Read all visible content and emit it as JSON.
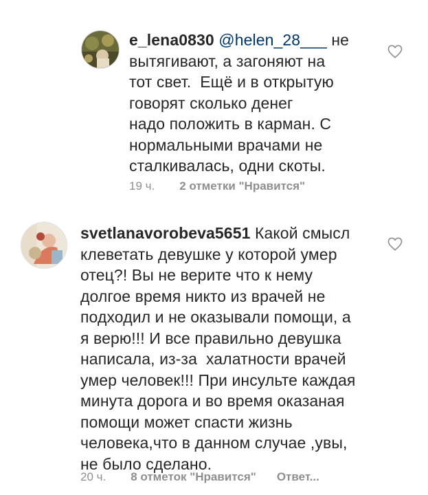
{
  "comments": [
    {
      "username": "e_lena0830",
      "mention": "@helen_28___",
      "line1_tail": " не",
      "lines": [
        "вытягивают, а загоняют на",
        "тот свет.  Ещё и в открытую",
        "говорят сколько денег",
        "надо положить в карман. С",
        "нормальными врачами не",
        "сталкивалась, одни скоты."
      ],
      "time": "19 ч.",
      "likes": "2 отметки \"Нравится\"",
      "avatar_icon": "user-avatar-photo",
      "like_icon": "heart-outline-icon"
    },
    {
      "username": "svetlanavorobeva5651",
      "line1_tail": " Какой смысл",
      "lines": [
        "клеветать девушке у которой умер",
        "отец?! Вы не верите что к нему",
        "долгое время никто из врачей не",
        "подходил и не оказывали помощи, а",
        "я верю!!! И все правильно девушка",
        "написала, из-за  халатности врачей",
        "умер человек!!! При инсульте каждая",
        "минута дорога и во время оказаная",
        "помощи может спасти жизнь",
        "человека,что в данном случае ,увы,",
        "не было сделано."
      ],
      "time": "20 ч.",
      "likes": "8 отметок \"Нравится\"",
      "reply": "Ответ...",
      "avatar_icon": "user-avatar-photo",
      "like_icon": "heart-outline-icon"
    }
  ],
  "colors": {
    "text": "#262626",
    "mention": "#003569",
    "meta": "#8e8e8e"
  }
}
